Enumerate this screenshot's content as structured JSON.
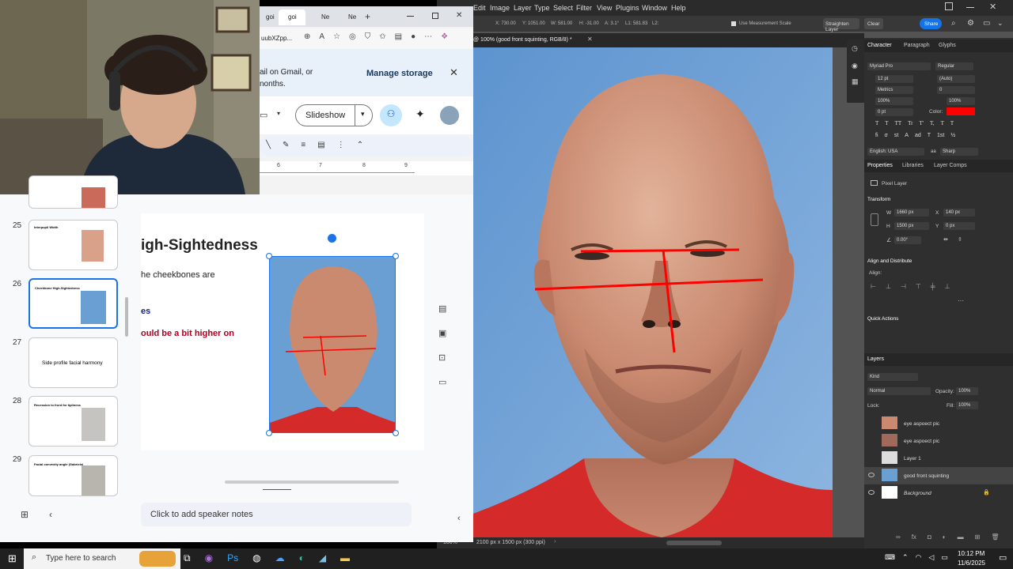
{
  "photoshop": {
    "menu": [
      "Edit",
      "Image",
      "Layer",
      "Type",
      "Select",
      "Filter",
      "View",
      "Plugins",
      "Window",
      "Help"
    ],
    "options": {
      "x": "X: 730.00",
      "y": "Y: 1051.00",
      "w": "W: 581.00",
      "h": "H: -31.00",
      "a": "A: 3.1°",
      "l1": "L1: 581.83",
      "l2": "L2:",
      "measure_scale": "Use Measurement Scale",
      "straighten": "Straighten Layer",
      "clear": "Clear",
      "share": "Share"
    },
    "doc_tab": "@ 100% (good front squinting, RGB/8) *",
    "status": {
      "zoom": "100%",
      "doc_info": "2100 px x 1500 px (300 ppi)"
    },
    "character": {
      "tabs": [
        "Character",
        "Paragraph",
        "Glyphs"
      ],
      "font_family": "Myriad Pro",
      "font_style": "Regular",
      "size": "12 pt",
      "leading": "(Auto)",
      "kerning": "Metrics",
      "tracking": "0",
      "vscale": "100%",
      "hscale": "100%",
      "baseline": "0 pt",
      "color_label": "Color:",
      "language": "English: USA",
      "aa_icon": "aa",
      "antialias": "Sharp",
      "typestyles": [
        "T",
        "T",
        "TT",
        "Tr",
        "T'",
        "T,",
        "T",
        "T"
      ],
      "opentype": [
        "fi",
        "σ",
        "st",
        "A",
        "ad",
        "T",
        "1st",
        "½"
      ]
    },
    "properties": {
      "tabs": [
        "Properties",
        "Libraries",
        "Layer Comps"
      ],
      "kind": "Pixel Layer",
      "transform": "Transform",
      "w": "1660 px",
      "h": "1500 px",
      "x": "140 px",
      "y": "0 px",
      "angle": "0.00°",
      "w_label": "W",
      "h_label": "H",
      "x_label": "X",
      "y_label": "Y",
      "align": "Align and Distribute",
      "align_sub": "Align:",
      "quick": "Quick Actions"
    },
    "layers": {
      "title": "Layers",
      "filter": "Kind",
      "blend": "Normal",
      "opacity_label": "Opacity:",
      "opacity": "100%",
      "lock_label": "Lock:",
      "fill_label": "Fill:",
      "fill": "100%",
      "items": [
        {
          "name": "eye aspoect pic",
          "visible": false
        },
        {
          "name": "eye aspoect pic",
          "visible": false
        },
        {
          "name": "Layer 1",
          "visible": false
        },
        {
          "name": "good front squinting",
          "visible": true
        },
        {
          "name": "Background",
          "visible": true
        }
      ]
    },
    "colors": {
      "accent": "#1473e6",
      "red": "#ff0000",
      "panel": "#2f2f2f"
    }
  },
  "browser": {
    "tabs": [
      "goi",
      "goi",
      "Ne",
      "Ne"
    ],
    "url": "uubXZpp...",
    "storage_text_1": "ail on Gmail, or",
    "storage_text_2": "nonths.",
    "manage_storage": "Manage storage",
    "slideshow": "Slideshow",
    "ruler": [
      "6",
      "7",
      "8",
      "9"
    ]
  },
  "slides": {
    "thumbs": [
      {
        "num": "25",
        "title": "Interpupil Width"
      },
      {
        "num": "26",
        "title": "Cheekbone High-Sightedness"
      },
      {
        "num": "27",
        "title": "Side profile facial harmony"
      },
      {
        "num": "28",
        "title": "Recession to front for tipliness"
      },
      {
        "num": "29",
        "title": "Facial convexity angle (Gabriele)"
      }
    ],
    "main_title": "igh-Sightedness",
    "body_1": "he cheekbones are",
    "body_2": "es",
    "body_3": "ould be a bit higher on",
    "notes": "Click to add speaker notes"
  },
  "taskbar": {
    "search": "Type here to search",
    "time": "10:12 PM",
    "date": "11/6/2025"
  }
}
